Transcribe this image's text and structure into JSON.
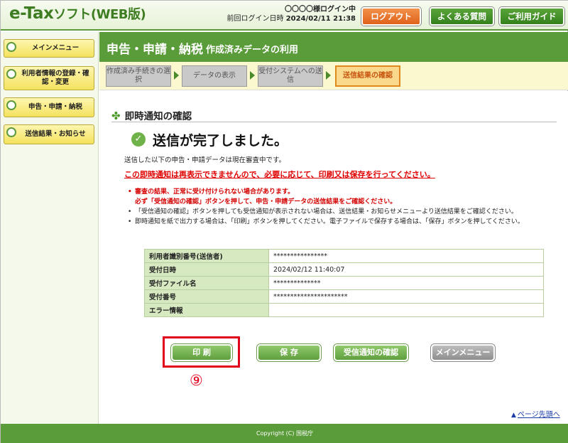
{
  "app": {
    "logo_main": "e-Tax",
    "logo_suffix": "ソフト(WEB版)"
  },
  "header": {
    "login_name": "〇〇〇〇様ログイン中",
    "last_login_label": "前回ログイン日時",
    "last_login_value": "2024/02/11 21:38",
    "logout_label": "ログアウト",
    "faq_label": "よくある質問",
    "guide_label": "ご利用ガイド"
  },
  "sidebar": {
    "items": [
      {
        "label": "メインメニュー"
      },
      {
        "label": "利用者情報の登録・確認・変更"
      },
      {
        "label": "申告・申請・納税"
      },
      {
        "label": "送信結果・お知らせ"
      }
    ]
  },
  "page": {
    "title": "申告・申請・納税",
    "subtitle": "作成済みデータの利用"
  },
  "steps": [
    {
      "label": "作成済み手続きの選択"
    },
    {
      "label": "データの表示"
    },
    {
      "label": "受付システムへの送信"
    },
    {
      "label": "送信結果の確認"
    }
  ],
  "content": {
    "section_title": "即時通知の確認",
    "done_text": "送信が完了しました。",
    "intro": "送信した以下の申告・申請データは現在審査中です。",
    "warning": "この即時通知は再表示できませんので、必要に応じて、印刷又は保存を行ってください。",
    "notes": [
      "審査の結果、正常に受け付けられない場合があります。",
      "必ず「受信通知の確認」ボタンを押して、申告・申請データの送信結果をご確認ください。",
      "「受信通知の確認」ボタンを押しても受信通知が表示されない場合は、送信結果・お知らせメニューより送信結果をご確認ください。",
      "即時通知を紙で出力する場合は、「印刷」ボタンを押してください。電子ファイルで保存する場合は、「保存」ボタンを押してください。"
    ],
    "table": [
      {
        "label": "利用者識別番号(送信者)",
        "value": "****************"
      },
      {
        "label": "受付日時",
        "value": "2024/02/12 11:40:07"
      },
      {
        "label": "受付ファイル名",
        "value": "**************"
      },
      {
        "label": "受付番号",
        "value": "**********************"
      },
      {
        "label": "エラー情報",
        "value": ""
      }
    ],
    "buttons": {
      "print": "印 刷",
      "save": "保 存",
      "receipt": "受信通知の確認",
      "menu": "メインメニュー"
    },
    "annotation": "⑨",
    "page_top": "ページ先頭へ"
  },
  "footer": {
    "copyright": "Copyright (C) 国税庁"
  },
  "colors": {
    "brand_green": "#5a9b3a",
    "logout_orange": "#e0621a",
    "warning_red": "#e00000",
    "highlight_red": "#e0001a"
  }
}
